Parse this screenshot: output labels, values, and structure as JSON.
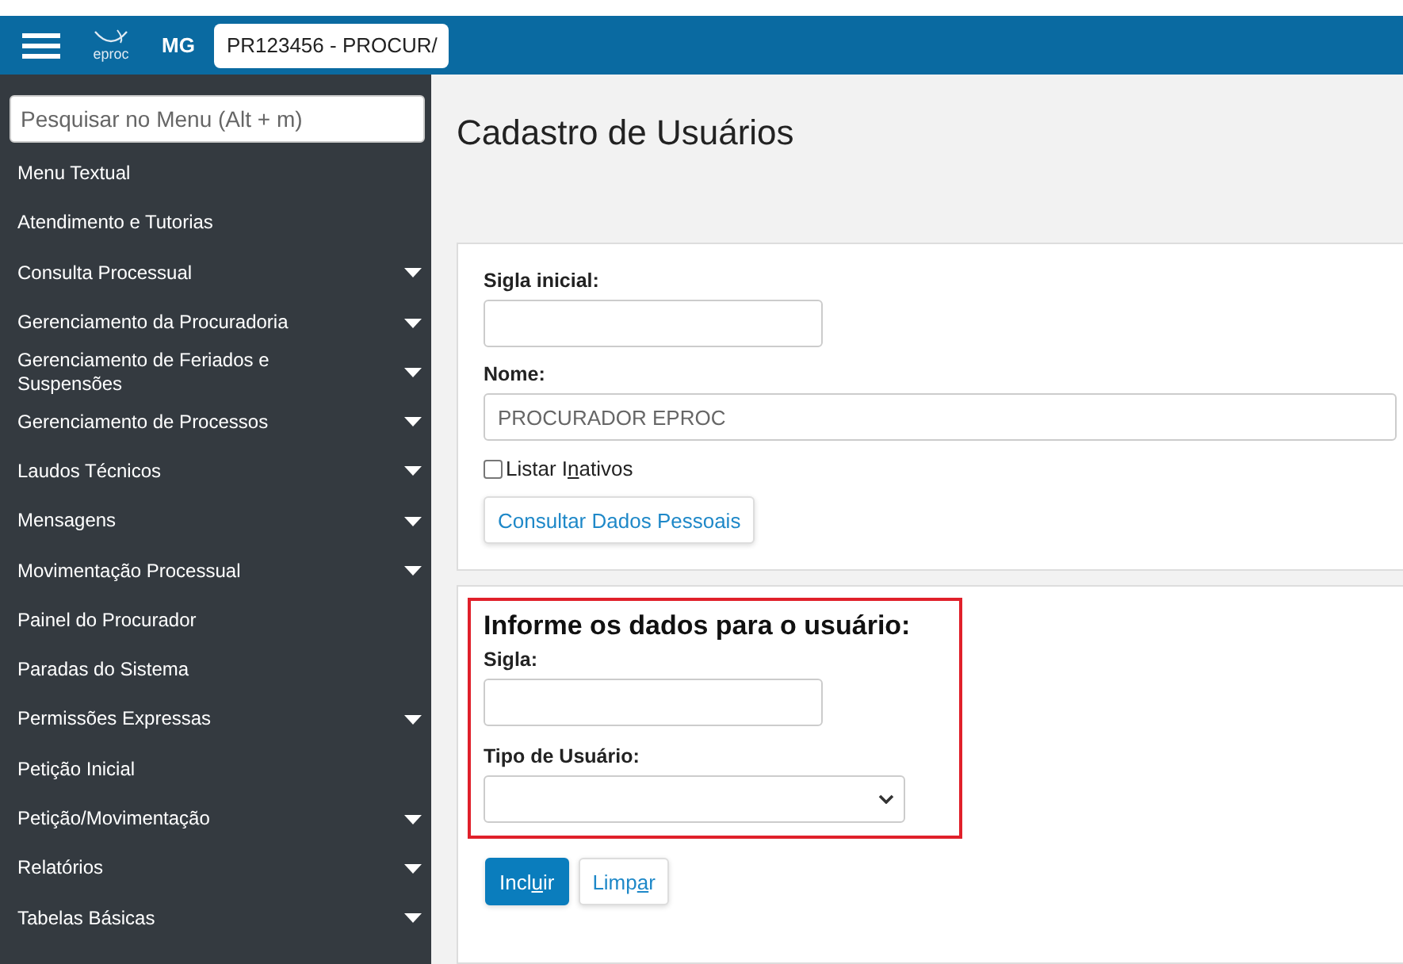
{
  "header": {
    "logo_text": "eproc",
    "state": "MG",
    "profile_select": "PR123456 - PROCUR/"
  },
  "sidebar": {
    "search": {
      "placeholder": "Pesquisar no Menu (Alt + m)"
    },
    "items": [
      {
        "label": "Menu Textual",
        "expandable": false
      },
      {
        "label": "Atendimento e Tutorias",
        "expandable": false
      },
      {
        "label": "Consulta Processual",
        "expandable": true
      },
      {
        "label": "Gerenciamento da Procuradoria",
        "expandable": true
      },
      {
        "label": "Gerenciamento de Feriados e Suspensões",
        "expandable": true
      },
      {
        "label": "Gerenciamento de Processos",
        "expandable": true
      },
      {
        "label": "Laudos Técnicos",
        "expandable": true
      },
      {
        "label": "Mensagens",
        "expandable": true
      },
      {
        "label": "Movimentação Processual",
        "expandable": true
      },
      {
        "label": "Painel do Procurador",
        "expandable": false
      },
      {
        "label": "Paradas do Sistema",
        "expandable": false
      },
      {
        "label": "Permissões Expressas",
        "expandable": true
      },
      {
        "label": "Petição Inicial",
        "expandable": false
      },
      {
        "label": "Petição/Movimentação",
        "expandable": true
      },
      {
        "label": "Relatórios",
        "expandable": true
      },
      {
        "label": "Tabelas Básicas",
        "expandable": true
      }
    ]
  },
  "page_title": "Cadastro de Usuários",
  "search_form": {
    "initials_label": "Sigla inicial:",
    "name_label": "Nome:",
    "name_value": "PROCURADOR EPROC",
    "inactive_checkbox": {
      "label_before": "Listar I",
      "access_key": "n",
      "label_after": "ativos",
      "checked": false
    },
    "consult_button": "Consultar Dados Pessoais"
  },
  "user_form": {
    "heading": "Informe os dados para o usuário:",
    "initials_label": "Sigla:",
    "type_label": "Tipo de Usuário:",
    "buttons": [
      {
        "kind": "primary",
        "label_before": "Incl",
        "access_key": "u",
        "label_after": "ir"
      },
      {
        "kind": "secondary",
        "label_before": "Limp",
        "access_key": "a",
        "label_after": "r"
      }
    ]
  }
}
